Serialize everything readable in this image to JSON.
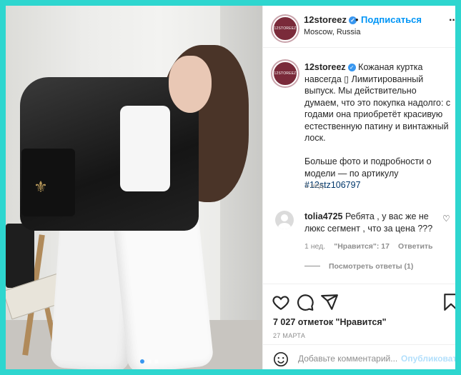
{
  "post": {
    "username": "12storeez",
    "avatar_text": "12STOREEZ",
    "follow_label": "Подписаться",
    "separator": "•",
    "location": "Moscow, Russia",
    "more_label": "···"
  },
  "caption": {
    "username": "12storeez",
    "text": "Кожаная куртка навсегда ▯ Лимитированный выпуск. Мы действительно думаем, что это покупка надолго: с годами она приобретёт красивую естественную патину и винтажный лоск.",
    "text2": "Больше фото и подробности о модели — по артикулу ",
    "hashtag": "#12stz106797",
    "time": "1 нед."
  },
  "reply": {
    "username": "tolia4725",
    "text": "Ребята , у вас же не люкс сегмент , что за цена ???",
    "time": "1 нед.",
    "likes": "\"Нравится\": 17",
    "reply_label": "Ответить",
    "view_replies": "Посмотреть ответы (1)"
  },
  "stats": {
    "likes": "7 027 отметок \"Нравится\"",
    "date": "27 МАРТА"
  },
  "comment_box": {
    "placeholder": "Добавьте комментарий...",
    "post_label": "Опубликовать"
  },
  "carousel": {
    "count": 3,
    "active_index": 0
  },
  "colors": {
    "accent": "#0095f6",
    "background": "#2ed6cf"
  }
}
